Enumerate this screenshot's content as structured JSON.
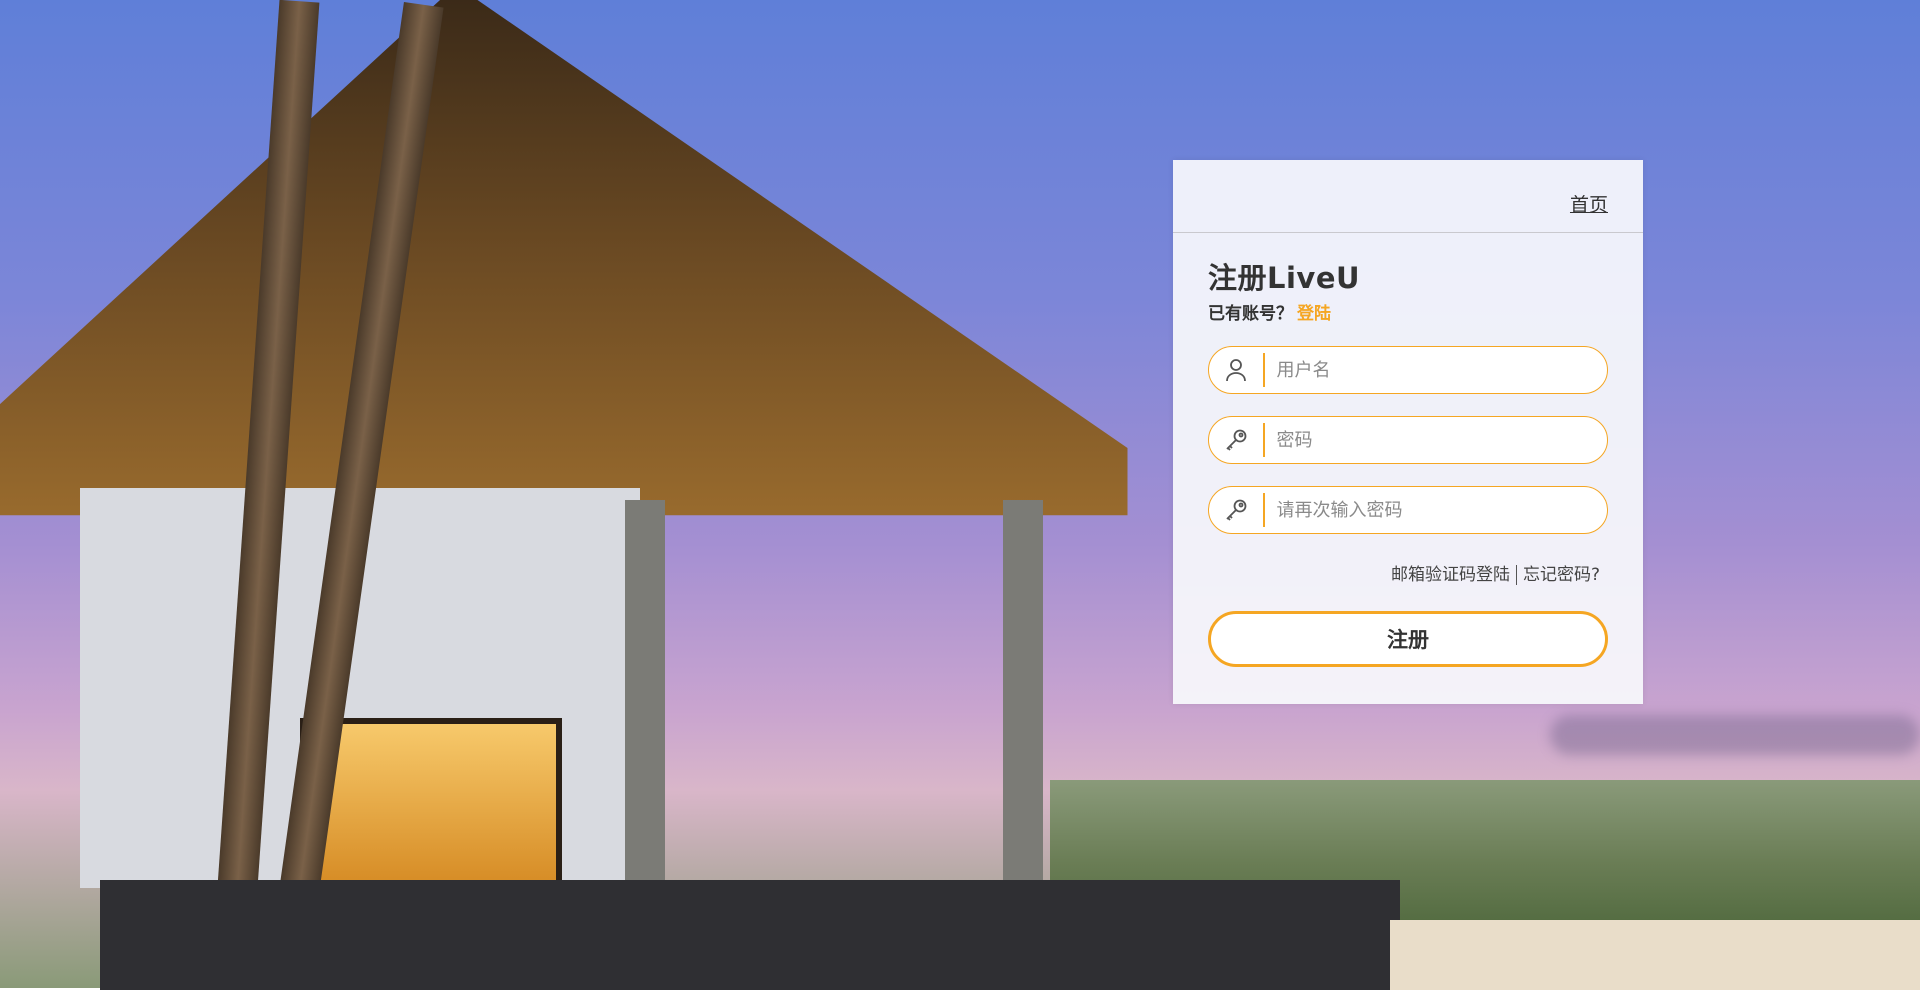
{
  "nav": {
    "home_label": "首页"
  },
  "header": {
    "title": "注册LiveU",
    "have_account_text": "已有账号？",
    "login_link": "登陆"
  },
  "form": {
    "username": {
      "value": "",
      "placeholder": "用户名",
      "icon": "user-icon"
    },
    "password": {
      "value": "",
      "placeholder": "密码",
      "icon": "key-icon"
    },
    "confirm_password": {
      "value": "",
      "placeholder": "请再次输入密码",
      "icon": "key-icon"
    },
    "email_login_link": "邮箱验证码登陆",
    "forgot_password_link": "忘记密码?",
    "submit_label": "注册"
  },
  "colors": {
    "accent": "#f5a623",
    "text": "#333333",
    "card_bg": "#f8f9fc"
  }
}
